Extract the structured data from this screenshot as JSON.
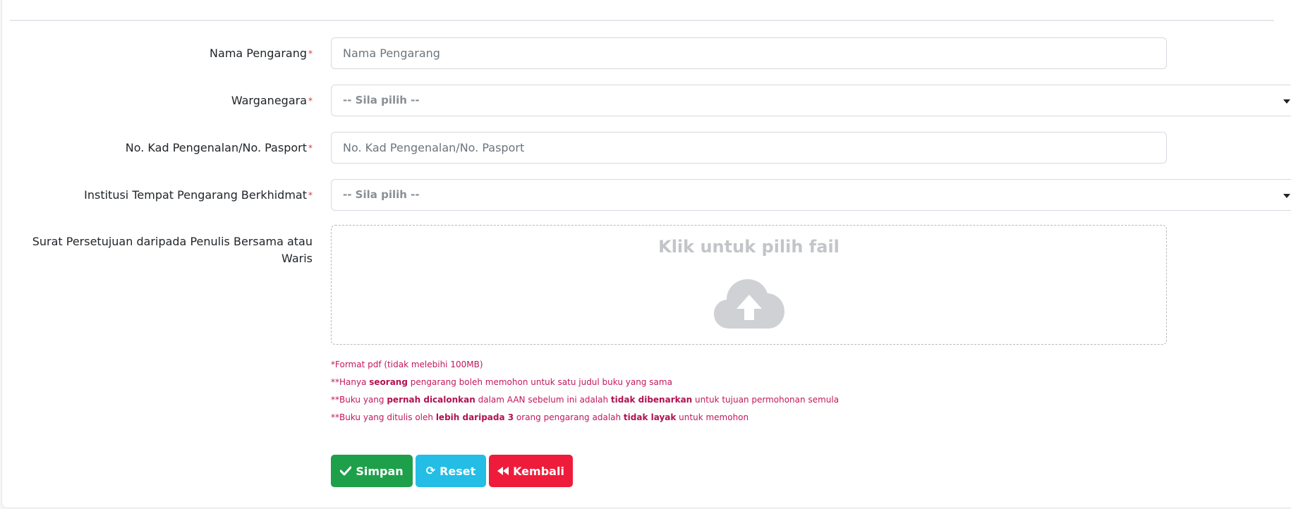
{
  "form": {
    "author_name": {
      "label": "Nama Pengarang",
      "required_mark": "*",
      "placeholder": "Nama Pengarang",
      "value": ""
    },
    "citizenship": {
      "label": "Warganegara",
      "required_mark": "*",
      "selected": "-- Sila pilih --"
    },
    "id_number": {
      "label": "No. Kad Pengenalan/No. Pasport",
      "required_mark": "*",
      "placeholder": "No. Kad Pengenalan/No. Pasport",
      "value": ""
    },
    "institution": {
      "label": "Institusi Tempat Pengarang Berkhidmat",
      "required_mark": "*",
      "selected": "-- Sila pilih --"
    },
    "consent_letter": {
      "label": "Surat Persetujuan daripada Penulis Bersama atau Waris",
      "dropzone_text": "Klik untuk pilih fail"
    }
  },
  "notes": {
    "format": "*Format pdf (tidak melebihi 100MB)",
    "note2": {
      "prefix": "**Hanya ",
      "bold": "seorang",
      "suffix": " pengarang boleh memohon untuk satu judul buku yang sama"
    },
    "note3": {
      "prefix": "**Buku yang ",
      "bold1": "pernah dicalonkan",
      "middle": " dalam AAN sebelum ini adalah ",
      "bold2": "tidak dibenarkan",
      "suffix": " untuk tujuan permohonan semula"
    },
    "note4": {
      "prefix": "**Buku yang ditulis oleh ",
      "bold1": "lebih daripada 3",
      "middle": " orang pengarang adalah ",
      "bold2": "tidak layak",
      "suffix": " untuk memohon"
    }
  },
  "buttons": {
    "save": "Simpan",
    "reset": "Reset",
    "back": "Kembali"
  },
  "colors": {
    "save": "#1ea04a",
    "reset": "#23bde6",
    "back": "#ee1c3a",
    "note_text": "#c2185b",
    "required": "#dc3545"
  },
  "icons": {
    "save": "check-icon",
    "reset": "refresh-icon",
    "back": "rewind-icon",
    "upload": "cloud-upload-icon"
  }
}
